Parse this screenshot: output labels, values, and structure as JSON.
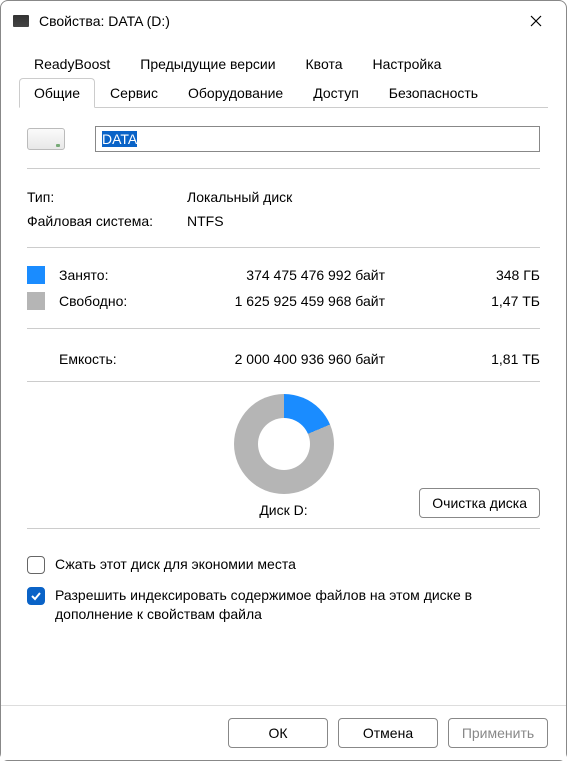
{
  "window": {
    "title": "Свойства: DATA (D:)"
  },
  "tabs": {
    "row1": [
      "ReadyBoost",
      "Предыдущие версии",
      "Квота",
      "Настройка"
    ],
    "row2": [
      "Общие",
      "Сервис",
      "Оборудование",
      "Доступ",
      "Безопасность"
    ],
    "active": "Общие"
  },
  "drive": {
    "name": "DATA"
  },
  "info": {
    "type_label": "Тип:",
    "type_value": "Локальный диск",
    "fs_label": "Файловая система:",
    "fs_value": "NTFS"
  },
  "space": {
    "used_label": "Занято:",
    "used_bytes": "374 475 476 992 байт",
    "used_human": "348 ГБ",
    "free_label": "Свободно:",
    "free_bytes": "1 625 925 459 968 байт",
    "free_human": "1,47 ТБ"
  },
  "capacity": {
    "label": "Емкость:",
    "bytes": "2 000 400 936 960 байт",
    "human": "1,81 ТБ"
  },
  "chart_data": {
    "type": "pie",
    "title": "Диск D:",
    "series": [
      {
        "name": "Занято",
        "value": 374475476992,
        "color": "#1a8cff"
      },
      {
        "name": "Свободно",
        "value": 1625925459968,
        "color": "#b5b5b5"
      }
    ]
  },
  "disk_caption": "Диск D:",
  "cleanup_label": "Очистка диска",
  "checks": {
    "compress": {
      "checked": false,
      "label": "Сжать этот диск для экономии места"
    },
    "index": {
      "checked": true,
      "label": "Разрешить индексировать содержимое файлов на этом диске в дополнение к свойствам файла"
    }
  },
  "buttons": {
    "ok": "ОК",
    "cancel": "Отмена",
    "apply": "Применить"
  }
}
